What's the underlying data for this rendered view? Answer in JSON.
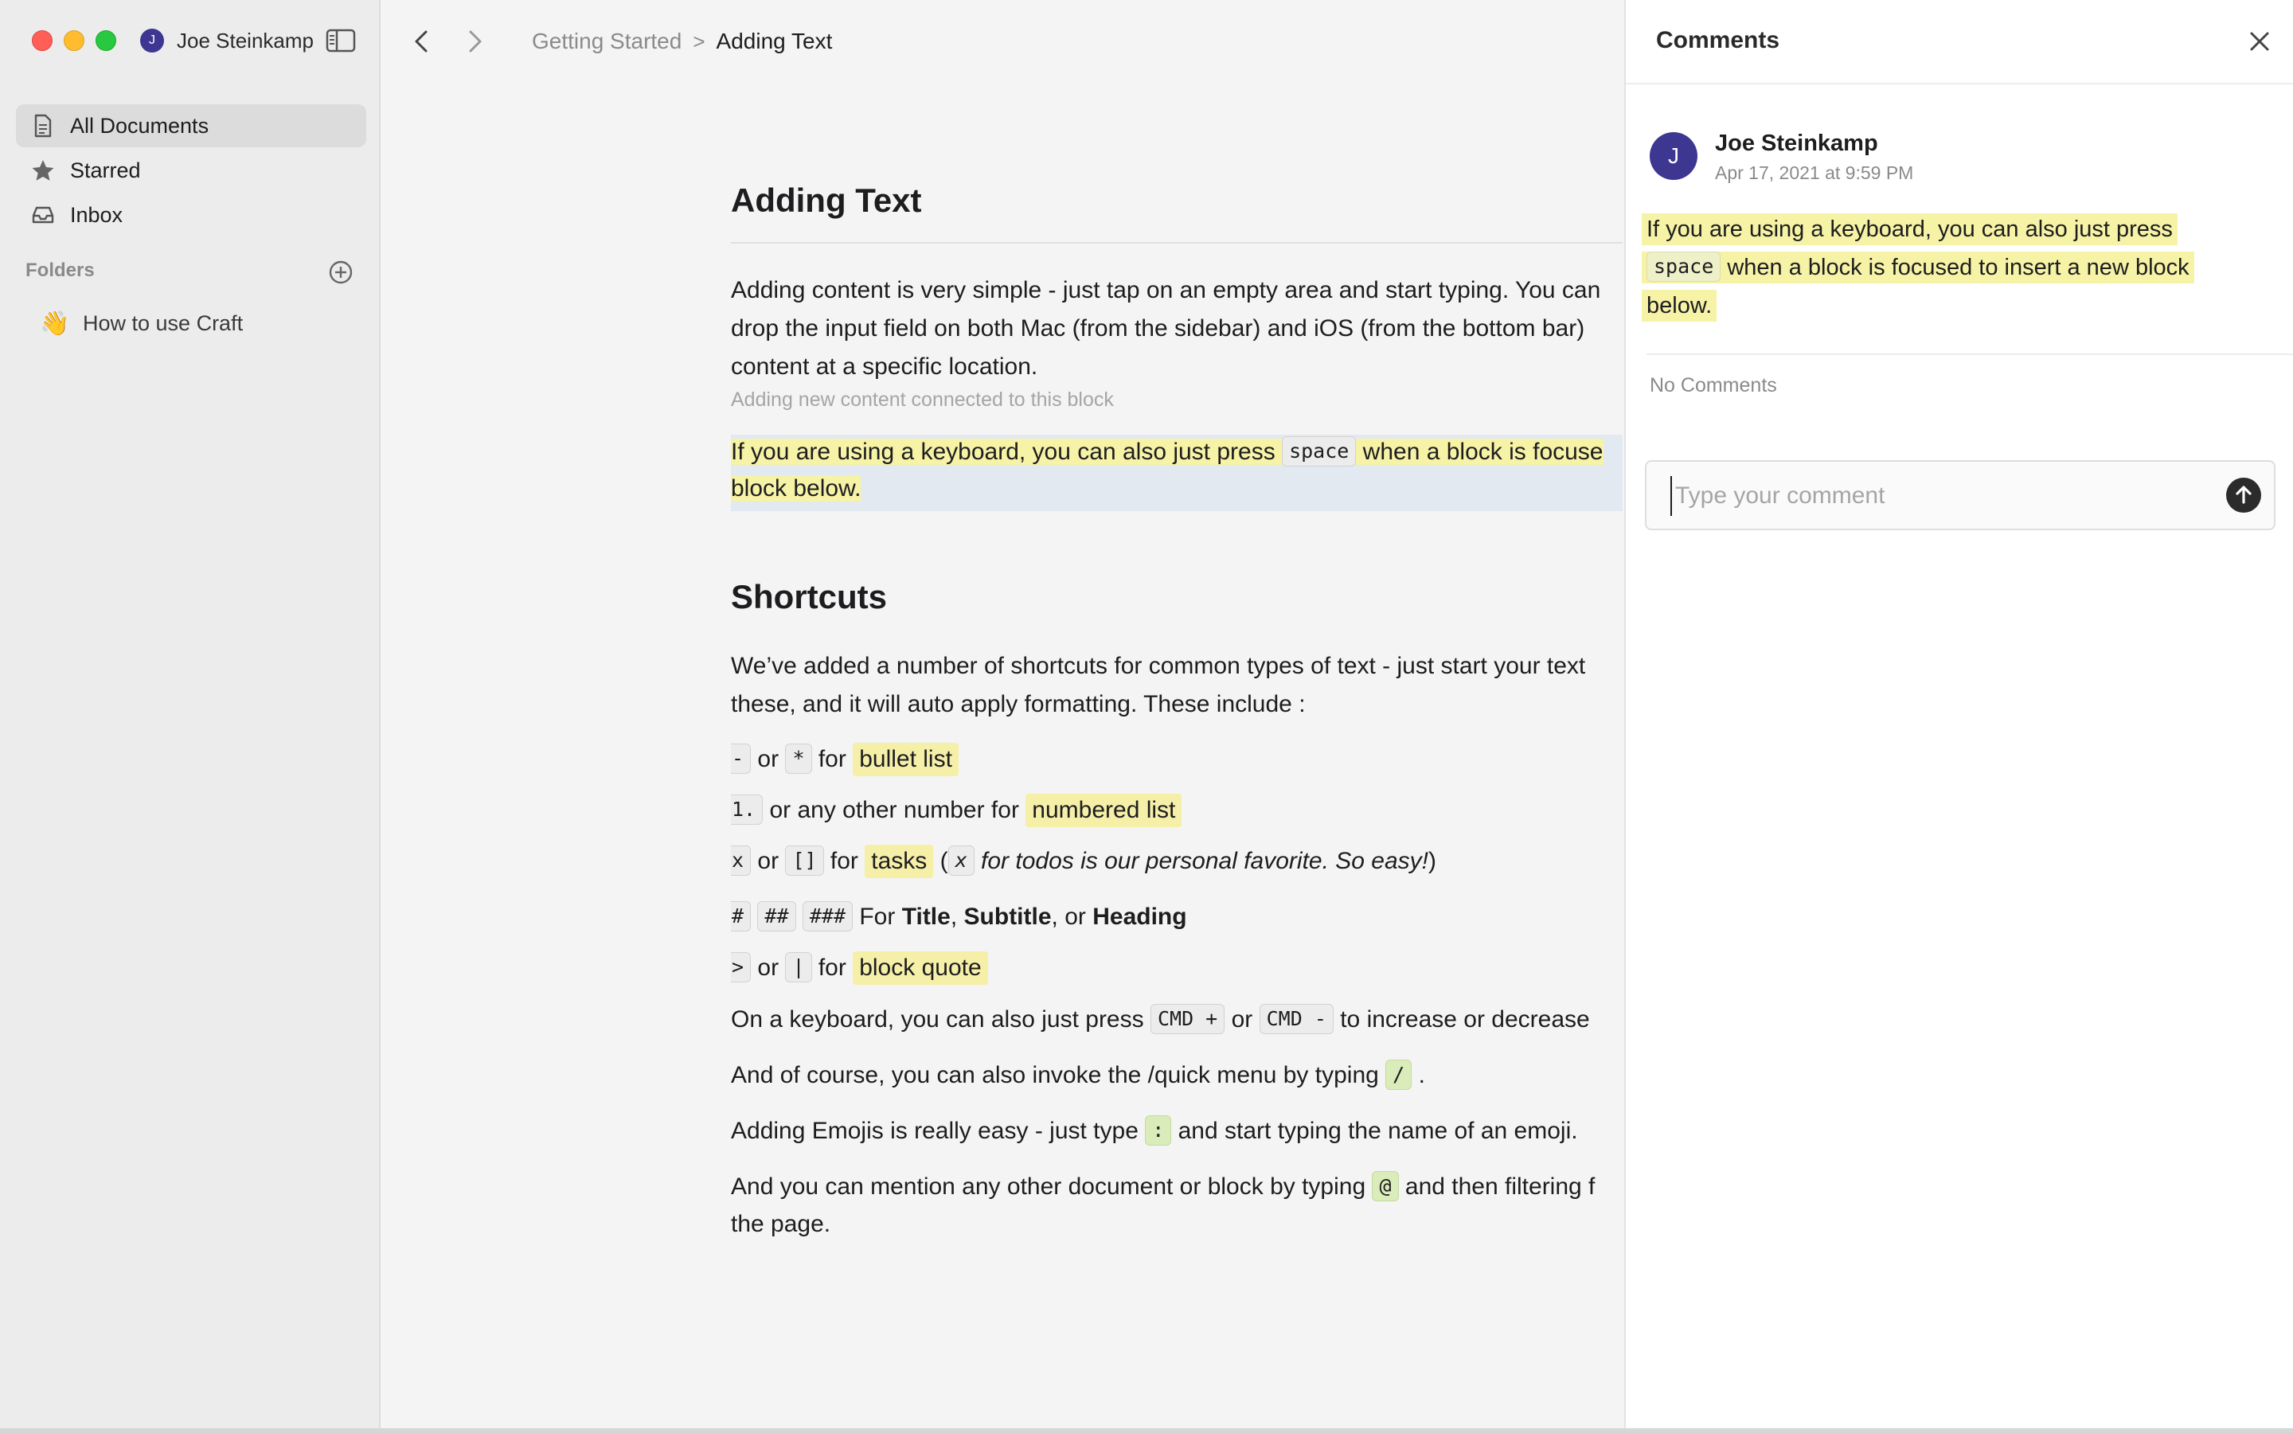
{
  "window": {
    "user": {
      "initial": "J",
      "name": "Joe Steinkamp"
    }
  },
  "sidebar": {
    "items": [
      {
        "label": "All Documents",
        "icon": "document-icon",
        "active": true
      },
      {
        "label": "Starred",
        "icon": "star-icon",
        "active": false
      },
      {
        "label": "Inbox",
        "icon": "inbox-icon",
        "active": false
      }
    ],
    "folders_label": "Folders",
    "folders": [
      {
        "emoji": "👋",
        "label": "How to use Craft"
      }
    ]
  },
  "topbar": {
    "breadcrumb": {
      "parent": "Getting Started",
      "separator": ">",
      "current": "Adding Text"
    }
  },
  "document": {
    "title": "Adding Text",
    "p1_line1": "Adding content is very simple - just tap on an empty area and start typing. You can",
    "p1_line2": "drop the input field on both Mac (from the sidebar) and iOS (from the bottom bar)",
    "p1_line3": "content at a specific location.",
    "hint": "Adding new content connected to this block",
    "hl_line1_a": "If you are using a keyboard, you can also just press ",
    "hl_line1_key": "space",
    "hl_line1_b": " when a block is focuse",
    "hl_line2": "block below.",
    "h2": "Shortcuts",
    "p2_line1": "We’ve added a number of shortcuts for common types of text - just start your text",
    "p2_line2": "these, and it will auto apply formatting. These include :",
    "bullet": {
      "key1": "-",
      "or": "or",
      "key2": "*",
      "for": "for",
      "label": "bullet list"
    },
    "numbered": {
      "key": "1.",
      "text": "or any other number for",
      "label": "numbered list"
    },
    "tasks": {
      "key1": "x",
      "or": "or",
      "key2": "[]",
      "for": "for",
      "label": "tasks",
      "paren_open": "(",
      "key3": "x",
      "note": "for todos is our personal favorite. So easy!",
      "paren_close": ")"
    },
    "headings": {
      "key1": "#",
      "key2": "##",
      "key3": "###",
      "for": "For",
      "title": "Title",
      "comma1": ",",
      "subtitle": "Subtitle",
      "or": ", or",
      "heading": "Heading"
    },
    "quote": {
      "key1": ">",
      "or": "or",
      "key2": "|",
      "for": "for",
      "label": "block quote"
    },
    "keyboard": {
      "a": "On a keyboard, you can also just press",
      "key1": "CMD +",
      "or": "or",
      "key2": "CMD -",
      "b": "to increase or decrease"
    },
    "quickmenu": {
      "a": "And of course, you can also invoke the /quick menu by typing",
      "key": "/",
      "b": "."
    },
    "emoji": {
      "a": "Adding Emojis is really easy - just type",
      "key": ":",
      "b": "and start typing the name of an emoji."
    },
    "mention": {
      "a": "And you can mention any other document or block by typing",
      "key": "@",
      "b": "and then filtering f",
      "line2": "the page."
    }
  },
  "comments": {
    "title": "Comments",
    "comment": {
      "initial": "J",
      "author": "Joe  Steinkamp",
      "date": "Apr 17, 2021 at 9:59 PM",
      "quote_a": "If you are using a keyboard, you can also just press",
      "quote_key": "space",
      "quote_b": "when a block is focused to insert a new block",
      "quote_c": "below."
    },
    "no_comments": "No Comments",
    "input_placeholder": "Type your comment"
  },
  "colors": {
    "accent_avatar": "#3d3791",
    "highlight_yellow": "#f6f2a6",
    "highlight_green": "#dfeec1",
    "selected_block": "#e3e9f1"
  }
}
